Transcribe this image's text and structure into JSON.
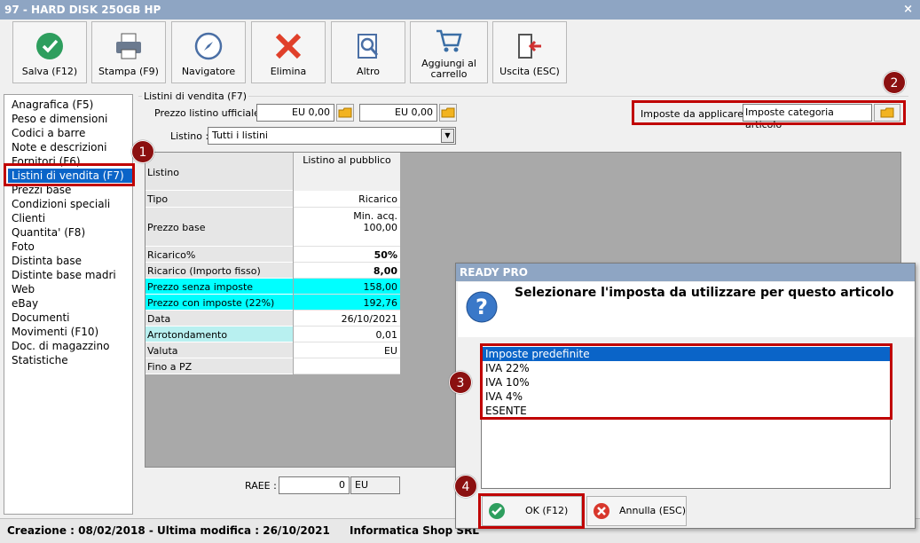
{
  "window": {
    "title": "97 - HARD DISK 250GB HP",
    "close": "×"
  },
  "toolbar": {
    "salva": "Salva (F12)",
    "stampa": "Stampa (F9)",
    "navigatore": "Navigatore",
    "elimina": "Elimina",
    "altro": "Altro",
    "carrello_1": "Aggiungi al",
    "carrello_2": "carrello",
    "uscita": "Uscita (ESC)"
  },
  "nav": {
    "items": [
      "Anagrafica (F5)",
      "Peso e dimensioni",
      "Codici a barre",
      "Note e descrizioni",
      "Fornitori (F6)",
      "Listini di vendita (F7)",
      "Prezzi base",
      "Condizioni speciali",
      "Clienti",
      "Quantita' (F8)",
      "Foto",
      "Distinta base",
      "Distinte base madri",
      "Web",
      "eBay",
      "Documenti",
      "Movimenti (F10)",
      "Doc. di magazzino",
      "Statistiche"
    ]
  },
  "form": {
    "group_title": "Listini di vendita (F7)",
    "prezzo_label": "Prezzo listino ufficiale :",
    "prezzo_1": "EU 0,00",
    "prezzo_2": "EU 0,00",
    "listino_label": "Listino :",
    "listino_value": "Tutti i listini",
    "imposte_label": "Imposte da applicare :",
    "imposte_value": "Imposte categoria articolo",
    "raee_label": "RAEE :",
    "raee_value": "0",
    "raee_unit": "EU"
  },
  "grid": {
    "col_header_left": "Listino",
    "col_header": "Listino al pubblico",
    "rows": [
      {
        "label": "Tipo",
        "value": "Ricarico"
      },
      {
        "label": "Prezzo base",
        "value": "Min. acq.",
        "value2": "100,00"
      },
      {
        "label": "Ricarico%",
        "value": "50%"
      },
      {
        "label": "Ricarico (Importo fisso)",
        "value": "8,00"
      },
      {
        "label": "Prezzo senza imposte",
        "value": "158,00"
      },
      {
        "label": "Prezzo con imposte (22%)",
        "value": "192,76"
      },
      {
        "label": "Data",
        "value": "26/10/2021"
      },
      {
        "label": "Arrotondamento",
        "value": "0,01"
      },
      {
        "label": "Valuta",
        "value": "EU"
      },
      {
        "label": "Fino a PZ",
        "value": ""
      }
    ]
  },
  "status": {
    "left": "Creazione : 08/02/2018 - Ultima modifica : 26/10/2021",
    "right": "Informatica Shop SRL"
  },
  "dialog": {
    "title": "READY PRO",
    "message": "Selezionare l'imposta da utilizzare per questo articolo",
    "options": [
      "Imposte predefinite",
      "IVA 22%",
      "IVA 10%",
      "IVA 4%",
      "ESENTE"
    ],
    "ok": "OK (F12)",
    "annulla": "Annulla (ESC)"
  },
  "badges": [
    "1",
    "2",
    "3",
    "4"
  ],
  "colors": {
    "accent": "#0a64c8",
    "highlight_cyan": "#00ffff",
    "annotation_red": "#c00000"
  }
}
